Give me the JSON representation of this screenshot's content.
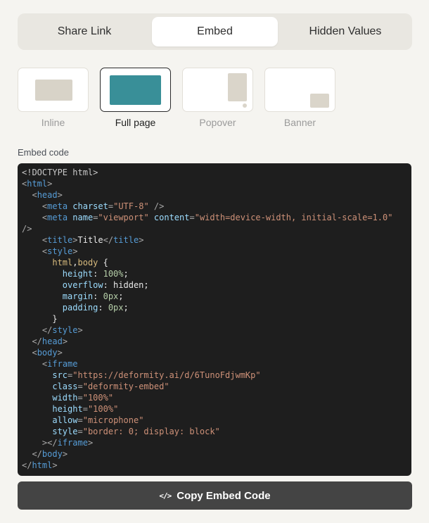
{
  "tabs": {
    "share_link": "Share Link",
    "embed": "Embed",
    "hidden_values": "Hidden Values",
    "active": "Embed"
  },
  "embed_types": {
    "selected": "Full page",
    "items": [
      {
        "label": "Inline"
      },
      {
        "label": "Full page"
      },
      {
        "label": "Popover"
      },
      {
        "label": "Banner"
      }
    ]
  },
  "colors": {
    "accent": "#398f98",
    "preview_shape": "#d8d3c8",
    "button_bg": "#444444",
    "code_bg": "#1e1e1e"
  },
  "embed_code": {
    "label": "Embed code",
    "lines": [
      [
        [
          "doc",
          "<!DOCTYPE html>"
        ]
      ],
      [
        [
          "punc",
          "<"
        ],
        [
          "tag",
          "html"
        ],
        [
          "punc",
          ">"
        ]
      ],
      [
        [
          "text",
          "  "
        ],
        [
          "punc",
          "<"
        ],
        [
          "tag",
          "head"
        ],
        [
          "punc",
          ">"
        ]
      ],
      [
        [
          "text",
          "    "
        ],
        [
          "punc",
          "<"
        ],
        [
          "tag",
          "meta"
        ],
        [
          "text",
          " "
        ],
        [
          "attr",
          "charset"
        ],
        [
          "punc",
          "="
        ],
        [
          "str",
          "\"UTF-8\""
        ],
        [
          "text",
          " "
        ],
        [
          "punc",
          "/>"
        ]
      ],
      [
        [
          "text",
          "    "
        ],
        [
          "punc",
          "<"
        ],
        [
          "tag",
          "meta"
        ],
        [
          "text",
          " "
        ],
        [
          "attr",
          "name"
        ],
        [
          "punc",
          "="
        ],
        [
          "str",
          "\"viewport\""
        ],
        [
          "text",
          " "
        ],
        [
          "attr",
          "content"
        ],
        [
          "punc",
          "="
        ],
        [
          "str",
          "\"width=device-width, initial-scale=1.0\""
        ]
      ],
      [
        [
          "punc",
          "/>"
        ]
      ],
      [
        [
          "text",
          "    "
        ],
        [
          "punc",
          "<"
        ],
        [
          "tag",
          "title"
        ],
        [
          "punc",
          ">"
        ],
        [
          "text",
          "Title"
        ],
        [
          "punc",
          "</"
        ],
        [
          "tag",
          "title"
        ],
        [
          "punc",
          ">"
        ]
      ],
      [
        [
          "text",
          "    "
        ],
        [
          "punc",
          "<"
        ],
        [
          "tag",
          "style"
        ],
        [
          "punc",
          ">"
        ]
      ],
      [
        [
          "text",
          "      "
        ],
        [
          "sel",
          "html"
        ],
        [
          "text",
          ","
        ],
        [
          "sel",
          "body"
        ],
        [
          "text",
          " {"
        ]
      ],
      [
        [
          "text",
          "        "
        ],
        [
          "prop",
          "height"
        ],
        [
          "text",
          ": "
        ],
        [
          "num",
          "100%"
        ],
        [
          "text",
          ";"
        ]
      ],
      [
        [
          "text",
          "        "
        ],
        [
          "prop",
          "overflow"
        ],
        [
          "text",
          ": hidden;"
        ]
      ],
      [
        [
          "text",
          "        "
        ],
        [
          "prop",
          "margin"
        ],
        [
          "text",
          ": "
        ],
        [
          "num",
          "0px"
        ],
        [
          "text",
          ";"
        ]
      ],
      [
        [
          "text",
          "        "
        ],
        [
          "prop",
          "padding"
        ],
        [
          "text",
          ": "
        ],
        [
          "num",
          "0px"
        ],
        [
          "text",
          ";"
        ]
      ],
      [
        [
          "text",
          "      }"
        ]
      ],
      [
        [
          "text",
          "    "
        ],
        [
          "punc",
          "</"
        ],
        [
          "tag",
          "style"
        ],
        [
          "punc",
          ">"
        ]
      ],
      [
        [
          "text",
          "  "
        ],
        [
          "punc",
          "</"
        ],
        [
          "tag",
          "head"
        ],
        [
          "punc",
          ">"
        ]
      ],
      [
        [
          "text",
          "  "
        ],
        [
          "punc",
          "<"
        ],
        [
          "tag",
          "body"
        ],
        [
          "punc",
          ">"
        ]
      ],
      [
        [
          "text",
          "    "
        ],
        [
          "punc",
          "<"
        ],
        [
          "tag",
          "iframe"
        ]
      ],
      [
        [
          "text",
          "      "
        ],
        [
          "attr",
          "src"
        ],
        [
          "punc",
          "="
        ],
        [
          "str",
          "\"https://deformity.ai/d/6TunoFdjwmKp\""
        ]
      ],
      [
        [
          "text",
          "      "
        ],
        [
          "attr",
          "class"
        ],
        [
          "punc",
          "="
        ],
        [
          "str",
          "\"deformity-embed\""
        ]
      ],
      [
        [
          "text",
          "      "
        ],
        [
          "attr",
          "width"
        ],
        [
          "punc",
          "="
        ],
        [
          "str",
          "\"100%\""
        ]
      ],
      [
        [
          "text",
          "      "
        ],
        [
          "attr",
          "height"
        ],
        [
          "punc",
          "="
        ],
        [
          "str",
          "\"100%\""
        ]
      ],
      [
        [
          "text",
          "      "
        ],
        [
          "attr",
          "allow"
        ],
        [
          "punc",
          "="
        ],
        [
          "str",
          "\"microphone\""
        ]
      ],
      [
        [
          "text",
          "      "
        ],
        [
          "attr",
          "style"
        ],
        [
          "punc",
          "="
        ],
        [
          "str",
          "\"border: 0; display: block\""
        ]
      ],
      [
        [
          "text",
          "    "
        ],
        [
          "punc",
          "></"
        ],
        [
          "tag",
          "iframe"
        ],
        [
          "punc",
          ">"
        ]
      ],
      [
        [
          "text",
          "  "
        ],
        [
          "punc",
          "</"
        ],
        [
          "tag",
          "body"
        ],
        [
          "punc",
          ">"
        ]
      ],
      [
        [
          "punc",
          "</"
        ],
        [
          "tag",
          "html"
        ],
        [
          "punc",
          ">"
        ]
      ]
    ]
  },
  "copy_button": {
    "icon": "code-icon",
    "icon_glyph": "</>",
    "label": "Copy Embed Code"
  }
}
